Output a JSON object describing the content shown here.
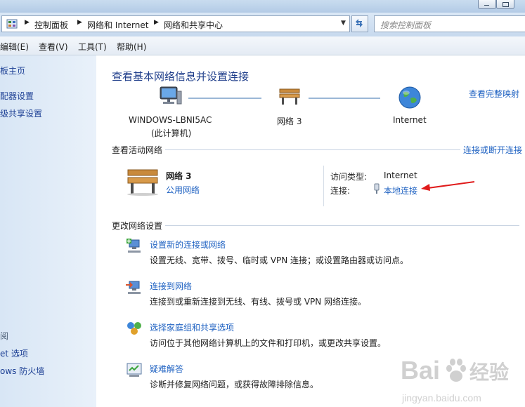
{
  "window": {
    "minimize": "minimize",
    "maximize": "maximize"
  },
  "address": {
    "crumbs": [
      "控制面板",
      "网络和 Internet",
      "网络和共享中心"
    ],
    "search_placeholder": "搜索控制面板"
  },
  "menu": [
    "编辑(E)",
    "查看(V)",
    "工具(T)",
    "帮助(H)"
  ],
  "left_pane": {
    "links": [
      "板主页",
      "配器设置",
      "级共享设置"
    ],
    "see_also_head": "阅",
    "see_also": [
      "et 选项",
      "ows 防火墙"
    ]
  },
  "main": {
    "title": "查看基本网络信息并设置连接",
    "full_map_link": "查看完整映射",
    "map": {
      "computer_name": "WINDOWS-LBNI5AC",
      "computer_sub": "(此计算机)",
      "network": "网络  3",
      "internet": "Internet"
    },
    "active_section": "查看活动网络",
    "connect_link": "连接或断开连接",
    "active_network": {
      "name": "网络  3",
      "type": "公用网络",
      "access_type_label": "访问类型:",
      "access_type_value": "Internet",
      "connection_label": "连接:",
      "connection_value": "本地连接"
    },
    "change_section": "更改网络设置",
    "tasks": [
      {
        "link": "设置新的连接或网络",
        "desc": "设置无线、宽带、拨号、临时或 VPN 连接；或设置路由器或访问点。"
      },
      {
        "link": "连接到网络",
        "desc": "连接到或重新连接到无线、有线、拨号或 VPN 网络连接。"
      },
      {
        "link": "选择家庭组和共享选项",
        "desc": "访问位于其他网络计算机上的文件和打印机，或更改共享设置。"
      },
      {
        "link": "疑难解答",
        "desc": "诊断并修复网络问题，或获得故障排除信息。"
      }
    ]
  },
  "watermark": {
    "brand_latin": "Bai",
    "brand_cn": "经验",
    "url": "jingyan.baidu.com"
  },
  "colors": {
    "link": "#1f62c2",
    "title": "#1e3d8a",
    "annotation_arrow": "#e01b1b"
  }
}
